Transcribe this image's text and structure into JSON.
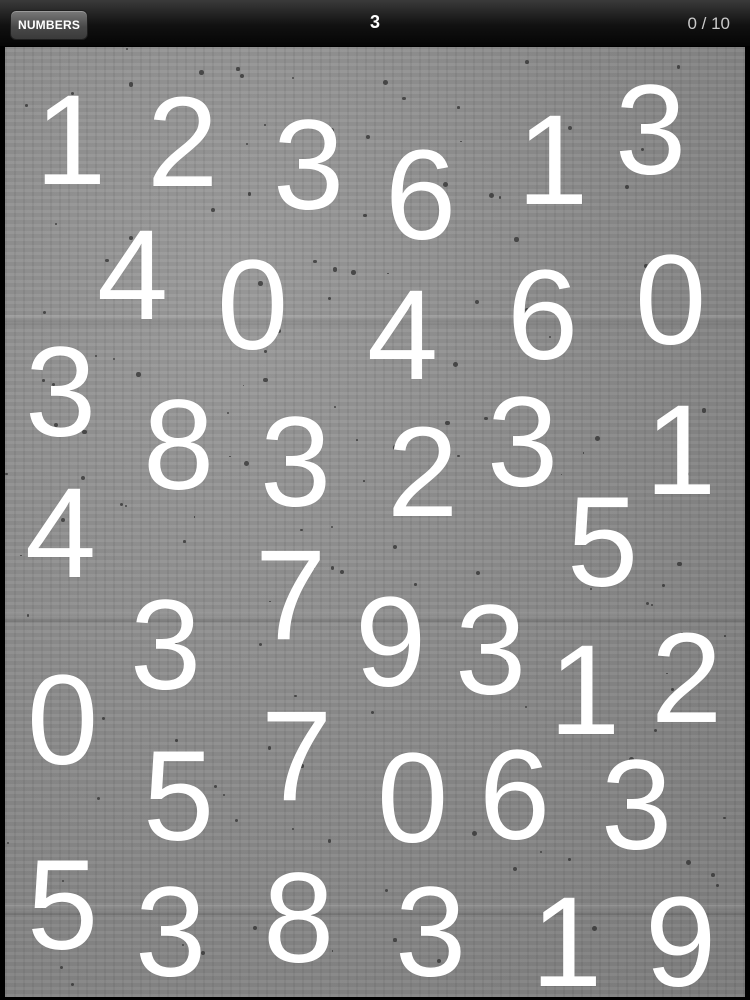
{
  "toolbar": {
    "menu_label": "NUMBERS",
    "target_number": "3",
    "score": "0 / 10"
  },
  "board": {
    "texture": "concrete",
    "digits": [
      "1",
      "2",
      "3",
      "6",
      "1",
      "3",
      "4",
      "0",
      "4",
      "6",
      "0",
      "3",
      "8",
      "3",
      "2",
      "3",
      "1",
      "4",
      "5",
      "7",
      "9",
      "3",
      "3",
      "1",
      "2",
      "0",
      "5",
      "7",
      "0",
      "6",
      "3",
      "5",
      "3",
      "8",
      "3",
      "1",
      "9"
    ]
  }
}
